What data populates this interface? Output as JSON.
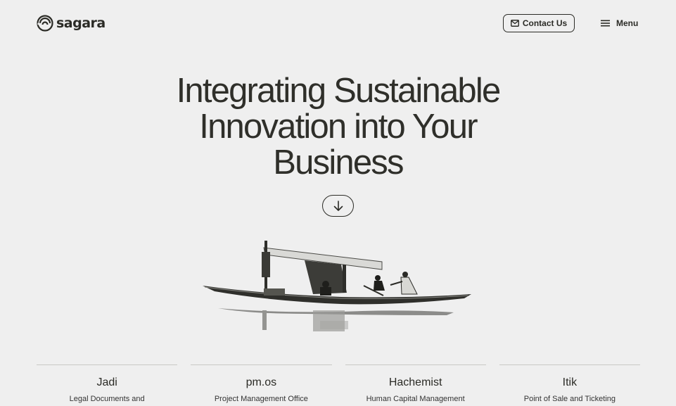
{
  "header": {
    "logo_text": "sagara",
    "contact_label": "Contact Us",
    "menu_label": "Menu"
  },
  "icons": {
    "logo": "sagara-logo-icon",
    "contact": "mail-icon",
    "menu": "hamburger-icon",
    "scroll": "arrow-down-icon"
  },
  "hero": {
    "line1": "Integrating Sustainable",
    "line2": "Innovation into Your",
    "line3": "Business",
    "image": "boat-photo"
  },
  "products": [
    {
      "name": "Jadi",
      "description": "Legal Documents and"
    },
    {
      "name": "pm.os",
      "description": "Project Management Office"
    },
    {
      "name": "Hachemist",
      "description": "Human Capital Management"
    },
    {
      "name": "Itik",
      "description": "Point of Sale and Ticketing"
    }
  ],
  "colors": {
    "background": "#efefef",
    "text": "#2b2b26",
    "divider": "#c9c9c5"
  }
}
